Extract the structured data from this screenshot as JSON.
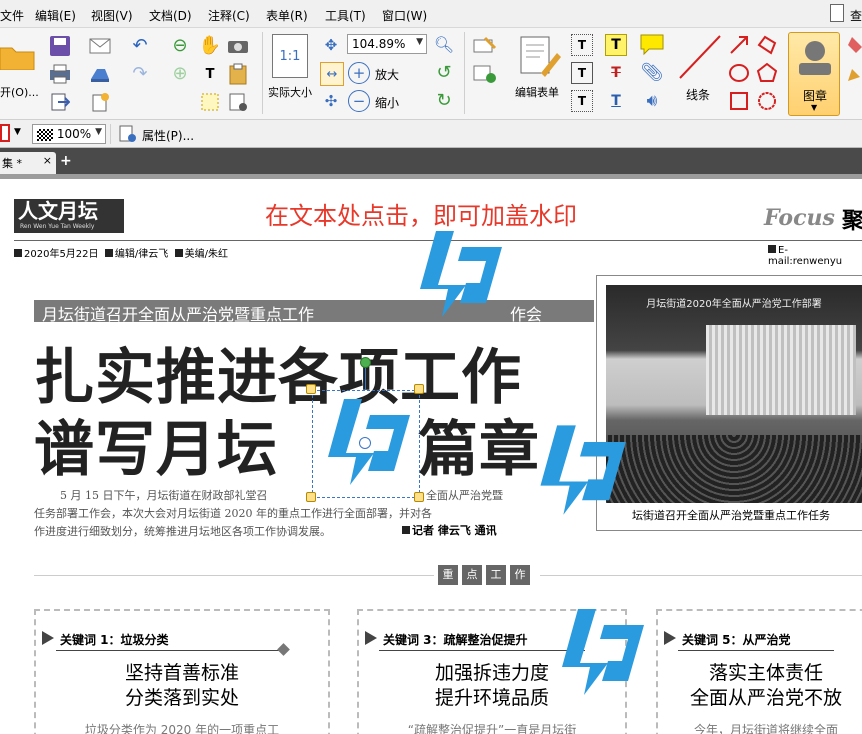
{
  "menubar": {
    "items": [
      "文件",
      "编辑(E)",
      "视图(V)",
      "文档(D)",
      "注释(C)",
      "表单(R)",
      "工具(T)",
      "窗口(W)"
    ],
    "right_label": "查"
  },
  "toolbar": {
    "open_label": "开(O)...",
    "zoom_value": "104.89%",
    "zoom_in_label": "放大",
    "zoom_out_label": "缩小",
    "actual_size_label": "实际大小",
    "actual_size_icon_text": "1:1",
    "edit_form_label": "编辑表单",
    "line_label": "线条",
    "stamp_label": "图章"
  },
  "propbar": {
    "opacity_value": "100%",
    "properties_label": "属性(P)..."
  },
  "tab": {
    "title": "集 *",
    "close": "×",
    "add": "+"
  },
  "document": {
    "instruction": "在文本处点击，即可加盖水印",
    "masthead": {
      "logo": "人文月坛",
      "logo_sub": "Ren Wen Yue Tan Weekly",
      "focus_label": "Focus",
      "focus_cn": "聚",
      "date": "2020年5月22日",
      "editor": "编辑/律云飞",
      "designer": "美编/朱红",
      "email": "E-mail:renwenyu"
    },
    "subhead": "月坛街道召开全面从严治党暨重点工作",
    "subhead_tail": "作会",
    "headline1": "扎实推进各项工作",
    "headline2": "谱写月坛",
    "headline2_tail": "篇章",
    "body_lines": [
      "5 月 15 日下午，月坛街道在财政部礼堂召",
      "任务部署工作会，本次大会对月坛街道 2020 年的重点工作进行全面部署，并对各",
      "作进度进行细致划分，统筹推进月坛地区各项工作协调发展。"
    ],
    "body_line1_tail": "全面从严治党暨",
    "reporter": "记者 律云飞 通讯",
    "photo_banner": "月坛街道2020年全面从严治党工作部署",
    "photo_caption": "坛街道召开全面从严治党暨重点工作任务",
    "section_title": [
      "重",
      "点",
      "工",
      "作"
    ],
    "cards": [
      {
        "keyword": "关键词 1：垃圾分类",
        "headline": [
          "坚持首善标准",
          "分类落到实处"
        ],
        "text": "垃圾分类作为 2020 年的一项重点工"
      },
      {
        "keyword": "关键词 3：疏解整治促提升",
        "headline": [
          "加强拆违力度",
          "提升环境品质"
        ],
        "text": "“疏解整治促提升”一直是月坛街"
      },
      {
        "keyword": "关键词 5：从严治党",
        "headline": [
          "落实主体责任",
          "全面从严治党不放"
        ],
        "text": "今年，月坛街道将继续全面"
      }
    ]
  },
  "colors": {
    "watermark_blue": "#2b9be0",
    "instruction_red": "#e8382a",
    "selection_blue": "#3a76c8"
  }
}
